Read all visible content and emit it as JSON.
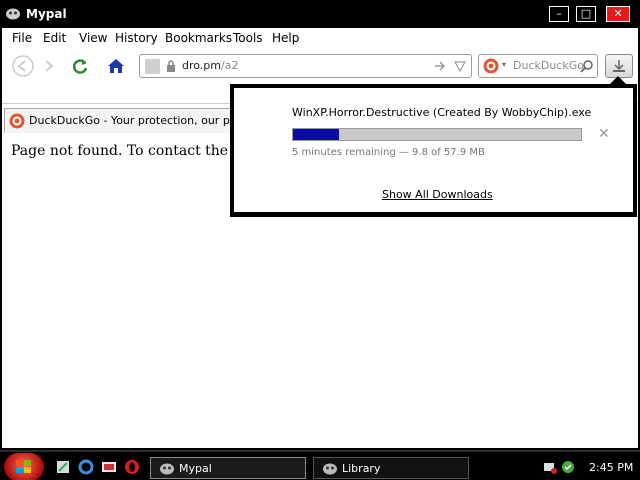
{
  "window": {
    "title": "Mypal",
    "minimize": "–",
    "maximize": "□",
    "close": "✕"
  },
  "menu": [
    {
      "label": "File",
      "access": "F"
    },
    {
      "label": "Edit",
      "access": "E"
    },
    {
      "label": "View",
      "access": "V"
    },
    {
      "label": "History",
      "access": "s"
    },
    {
      "label": "Bookmarks",
      "access": "B"
    },
    {
      "label": "Tools",
      "access": "T"
    },
    {
      "label": "Help",
      "access": "H"
    }
  ],
  "address": {
    "host": "dro.pm",
    "path": "/a2"
  },
  "search": {
    "placeholder": "DuckDuckGo"
  },
  "tab": {
    "label": "DuckDuckGo - Your protection, our priority"
  },
  "page": {
    "text": "Page not found. To contact the admi"
  },
  "download": {
    "filename": "WinXP.Horror.Destructive  (Created By WobbyChip).exe",
    "progress": 0.16,
    "status": "5 minutes remaining — 9.8 of 57.9 MB",
    "show_all": "Show All Downloads",
    "cancel": "✕"
  },
  "taskbar": {
    "tasks": [
      {
        "label": "Mypal"
      },
      {
        "label": "Library"
      }
    ],
    "clock": "2:45 PM"
  },
  "colors": {
    "progress_fill": "#0a0aa8",
    "start_button": "#c81616"
  }
}
